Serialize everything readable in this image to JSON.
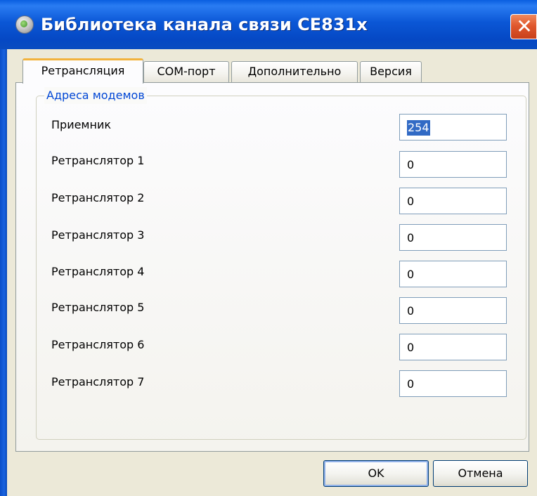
{
  "window": {
    "title": "Библиотека канала связи CE831x",
    "close_glyph": "✕"
  },
  "tabs": [
    {
      "label": "Ретрансляция",
      "active": true
    },
    {
      "label": "COM-порт",
      "active": false
    },
    {
      "label": "Дополнительно",
      "active": false
    },
    {
      "label": "Версия",
      "active": false
    }
  ],
  "group": {
    "title": "Адреса модемов",
    "fields": [
      {
        "label": "Приемник",
        "value": "254",
        "selected": true
      },
      {
        "label": "Ретранслятор 1",
        "value": "0"
      },
      {
        "label": "Ретранслятор 2",
        "value": "0"
      },
      {
        "label": "Ретранслятор 3",
        "value": "0"
      },
      {
        "label": "Ретранслятор 4",
        "value": "0"
      },
      {
        "label": "Ретранслятор 5",
        "value": "0"
      },
      {
        "label": "Ретранслятор 6",
        "value": "0"
      },
      {
        "label": "Ретранслятор 7",
        "value": "0"
      }
    ]
  },
  "buttons": {
    "ok_label": "OK",
    "cancel_label": "Отмена"
  },
  "colors": {
    "titlebar": "#0b57d6",
    "accent_tab": "#f2b33d",
    "group_title": "#0046d5",
    "selection": "#316ac5"
  }
}
